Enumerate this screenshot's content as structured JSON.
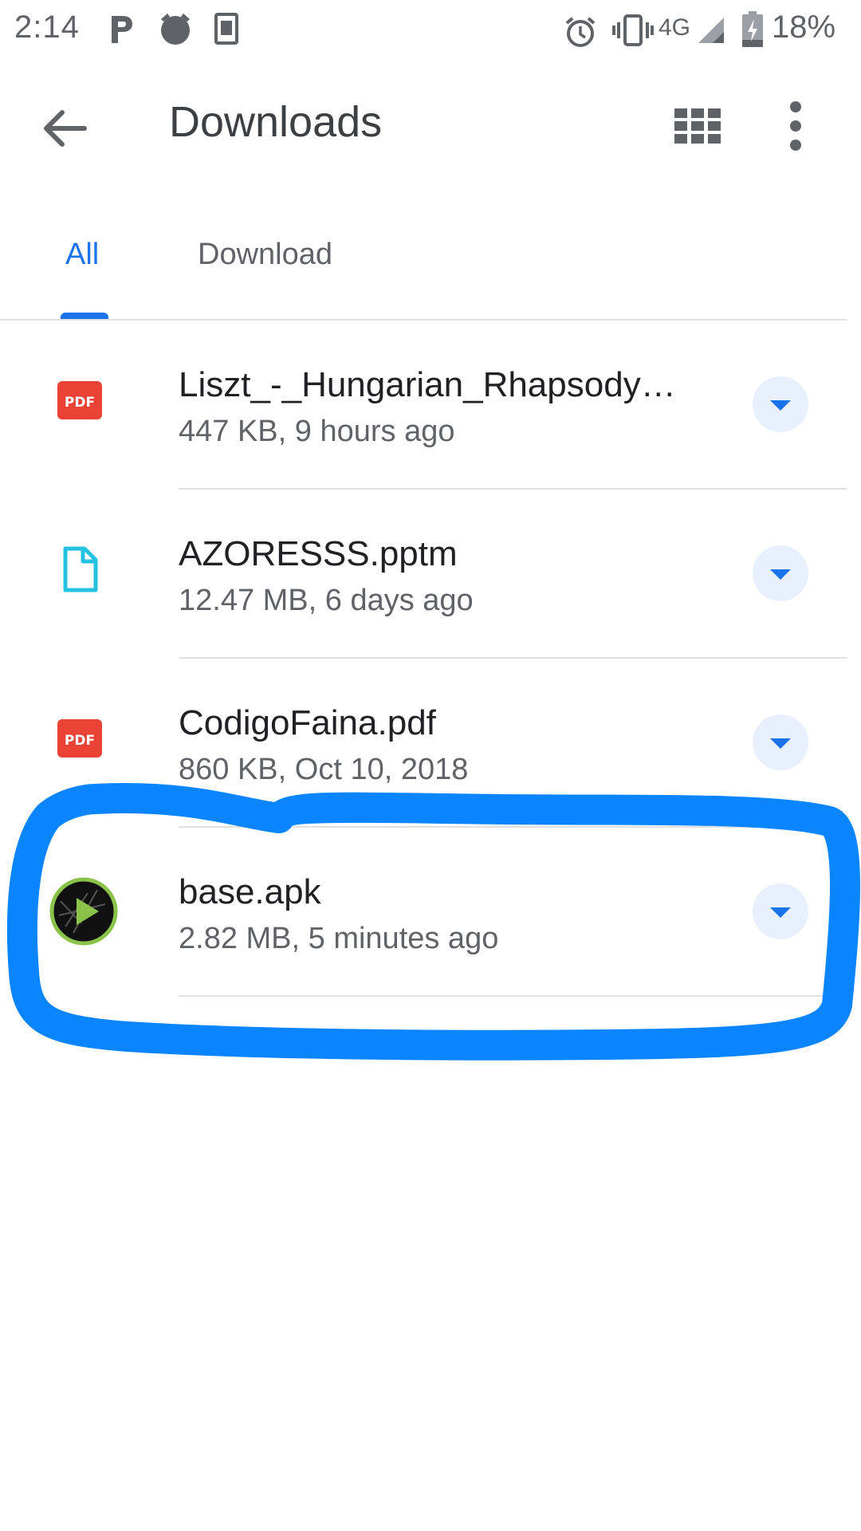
{
  "status_bar": {
    "time": "2:14",
    "network": "4G",
    "battery": "18%"
  },
  "app_bar": {
    "title": "Downloads"
  },
  "tabs": [
    {
      "label": "All",
      "selected": true
    },
    {
      "label": "Download",
      "selected": false
    }
  ],
  "files": [
    {
      "name": "Liszt_-_Hungarian_Rhapsody…",
      "meta": "447 KB, 9 hours ago",
      "icon": "pdf-icon",
      "badge": "PDF"
    },
    {
      "name": "AZORESSS.pptm",
      "meta": "12.47 MB, 6 days ago",
      "icon": "document-icon"
    },
    {
      "name": "CodigoFaina.pdf",
      "meta": "860 KB, Oct 10, 2018",
      "icon": "pdf-icon",
      "badge": "PDF"
    },
    {
      "name": "base.apk",
      "meta": "2.82 MB, 5 minutes ago",
      "icon": "apk-app-icon"
    }
  ],
  "colors": {
    "accent": "#1a73e8",
    "pdf_red": "#ea4335",
    "doc_cyan": "#24c1e0",
    "scribble_blue": "#0a84ff",
    "menu_chip": "#e8f0fe"
  }
}
